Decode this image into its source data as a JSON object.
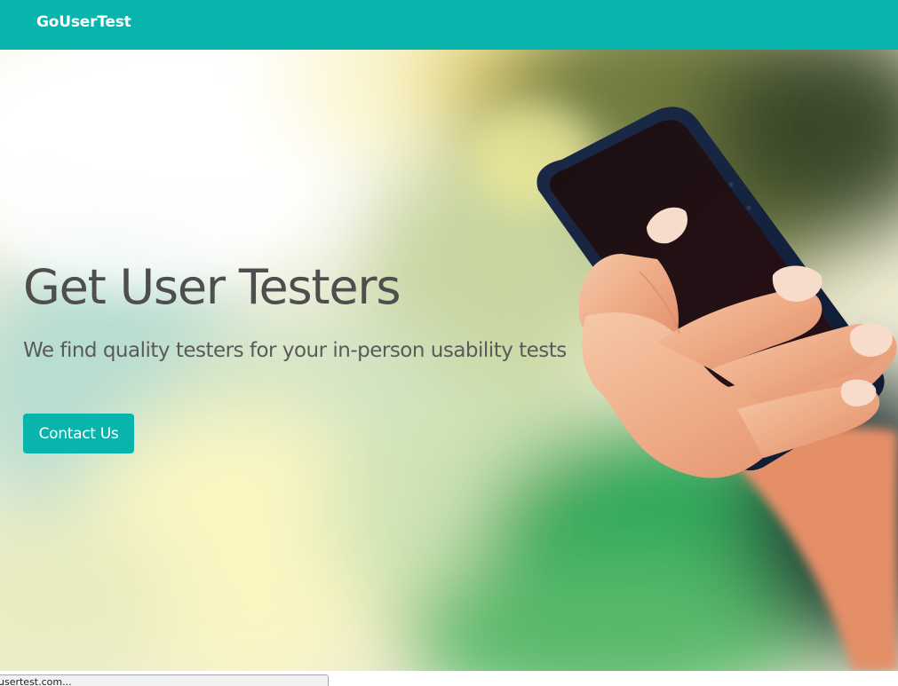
{
  "navbar": {
    "brand": "GoUserTest"
  },
  "hero": {
    "title": "Get User Testers",
    "subtitle": "We find quality testers for your in-person usability tests",
    "cta_label": "Contact Us",
    "photo_subject": "hand holding smartphone"
  },
  "status_bar": {
    "text": "usertest.com..."
  },
  "colors": {
    "accent": "#08b4ac",
    "title_text": "#4e4e4e",
    "subtitle_text": "#5a5a5a"
  }
}
